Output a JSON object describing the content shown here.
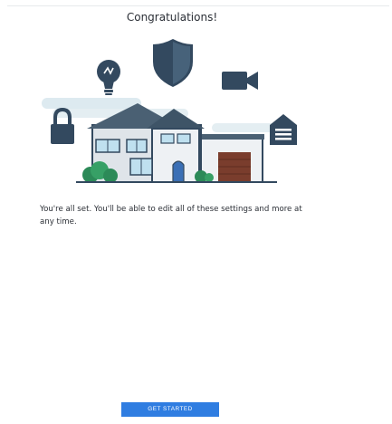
{
  "header": {
    "title": "Congratulations!"
  },
  "hero": {
    "icons": [
      "lightbulb-icon",
      "shield-icon",
      "video-camera-icon",
      "lock-icon",
      "garage-icon"
    ],
    "colors": {
      "icon_navy": "#33495f",
      "roof": "#4a6073",
      "wall": "#d9dee3",
      "garage_door": "#7a3d2d",
      "bush": "#2c8a58",
      "door": "#3a6fb5",
      "cloud": "#ddeaf0"
    }
  },
  "message": {
    "text": "You're all set. You'll be able to edit all of these settings and more at any time."
  },
  "cta": {
    "label": "GET STARTED",
    "color": "#2f7de1"
  }
}
